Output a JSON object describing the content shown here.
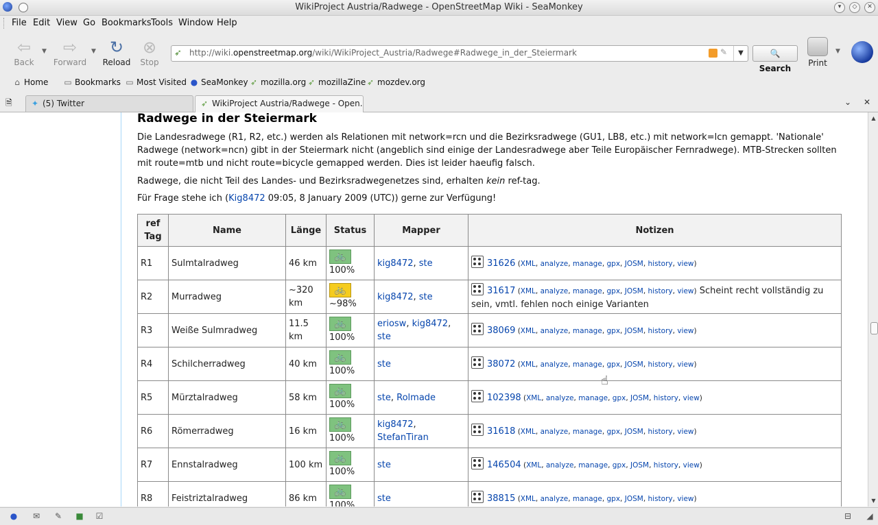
{
  "window": {
    "title": "WikiProject Austria/Radwege - OpenStreetMap Wiki - SeaMonkey"
  },
  "menu": [
    "File",
    "Edit",
    "View",
    "Go",
    "Bookmarks",
    "Tools",
    "Window",
    "Help"
  ],
  "toolbar": {
    "back": "Back",
    "forward": "Forward",
    "reload": "Reload",
    "stop": "Stop",
    "url_prefix": "http://wiki.",
    "url_domain": "openstreetmap.org",
    "url_rest": "/wiki/WikiProject_Austria/Radwege#Radwege_in_der_Steiermark",
    "search": "Search",
    "print": "Print"
  },
  "bookmarks": [
    "Home",
    "Bookmarks",
    "Most Visited",
    "SeaMonkey",
    "mozilla.org",
    "mozillaZine",
    "mozdev.org"
  ],
  "tabs": [
    {
      "label": "(5) Twitter"
    },
    {
      "label": "WikiProject Austria/Radwege - Open..."
    }
  ],
  "page": {
    "heading": "Radwege in der Steiermark",
    "para1": "Die Landesradwege (R1, R2, etc.) werden als Relationen mit network=rcn und die Bezirksradwege (GU1, LB8, etc.) mit network=lcn gemappt. 'Nationale' Radwege (network=ncn) gibt in der Steiermark nicht (angeblich sind einige der Landesradwege aber Teile Europäischer Fernradwege). MTB-Strecken sollten mit route=mtb und nicht route=bicycle gemapped werden. Dies ist leider haeufig falsch.",
    "para2_pre": "Radwege, die nicht Teil des Landes- und Bezirksradwegenetzes sind, erhalten ",
    "para2_em": "kein",
    "para2_post": " ref-tag.",
    "para3_pre": "Für Frage stehe ich (",
    "para3_link": "Kig8472",
    "para3_post": " 09:05, 8 January 2009 (UTC)) gerne zur Verfügung!"
  },
  "table": {
    "headers": [
      "ref Tag",
      "Name",
      "Länge",
      "Status",
      "Mapper",
      "Notizen"
    ],
    "tool_links": [
      "XML",
      "analyze",
      "manage",
      "gpx",
      "JOSM",
      "history",
      "view"
    ],
    "rows": [
      {
        "ref": "R1",
        "name": "Sulmtalradweg",
        "length": "46 km",
        "status": "100%",
        "status_color": "#7fc27f",
        "mappers": [
          "kig8472",
          "ste"
        ],
        "relation": "31626",
        "note": ""
      },
      {
        "ref": "R2",
        "name": "Murradweg",
        "length": "~320 km",
        "status": "~98%",
        "status_color": "#f5cc1e",
        "mappers": [
          "kig8472",
          "ste"
        ],
        "relation": "31617",
        "note": "Scheint recht vollständig zu sein, vmtl. fehlen noch einige Varianten"
      },
      {
        "ref": "R3",
        "name": "Weiße Sulmradweg",
        "length": "11.5 km",
        "status": "100%",
        "status_color": "#7fc27f",
        "mappers": [
          "eriosw",
          "kig8472",
          "ste"
        ],
        "relation": "38069",
        "note": ""
      },
      {
        "ref": "R4",
        "name": "Schilcherradweg",
        "length": "40 km",
        "status": "100%",
        "status_color": "#7fc27f",
        "mappers": [
          "ste"
        ],
        "relation": "38072",
        "note": ""
      },
      {
        "ref": "R5",
        "name": "Mürztalradweg",
        "length": "58 km",
        "status": "100%",
        "status_color": "#7fc27f",
        "mappers": [
          "ste",
          "Rolmade"
        ],
        "relation": "102398",
        "note": ""
      },
      {
        "ref": "R6",
        "name": "Römerradweg",
        "length": "16 km",
        "status": "100%",
        "status_color": "#7fc27f",
        "mappers": [
          "kig8472",
          "StefanTiran"
        ],
        "relation": "31618",
        "note": ""
      },
      {
        "ref": "R7",
        "name": "Ennstalradweg",
        "length": "100 km",
        "status": "100%",
        "status_color": "#7fc27f",
        "mappers": [
          "ste"
        ],
        "relation": "146504",
        "note": ""
      },
      {
        "ref": "R8",
        "name": "Feistriztalradweg",
        "length": "86 km",
        "status": "100%",
        "status_color": "#7fc27f",
        "mappers": [
          "ste"
        ],
        "relation": "38815",
        "note": ""
      }
    ]
  }
}
